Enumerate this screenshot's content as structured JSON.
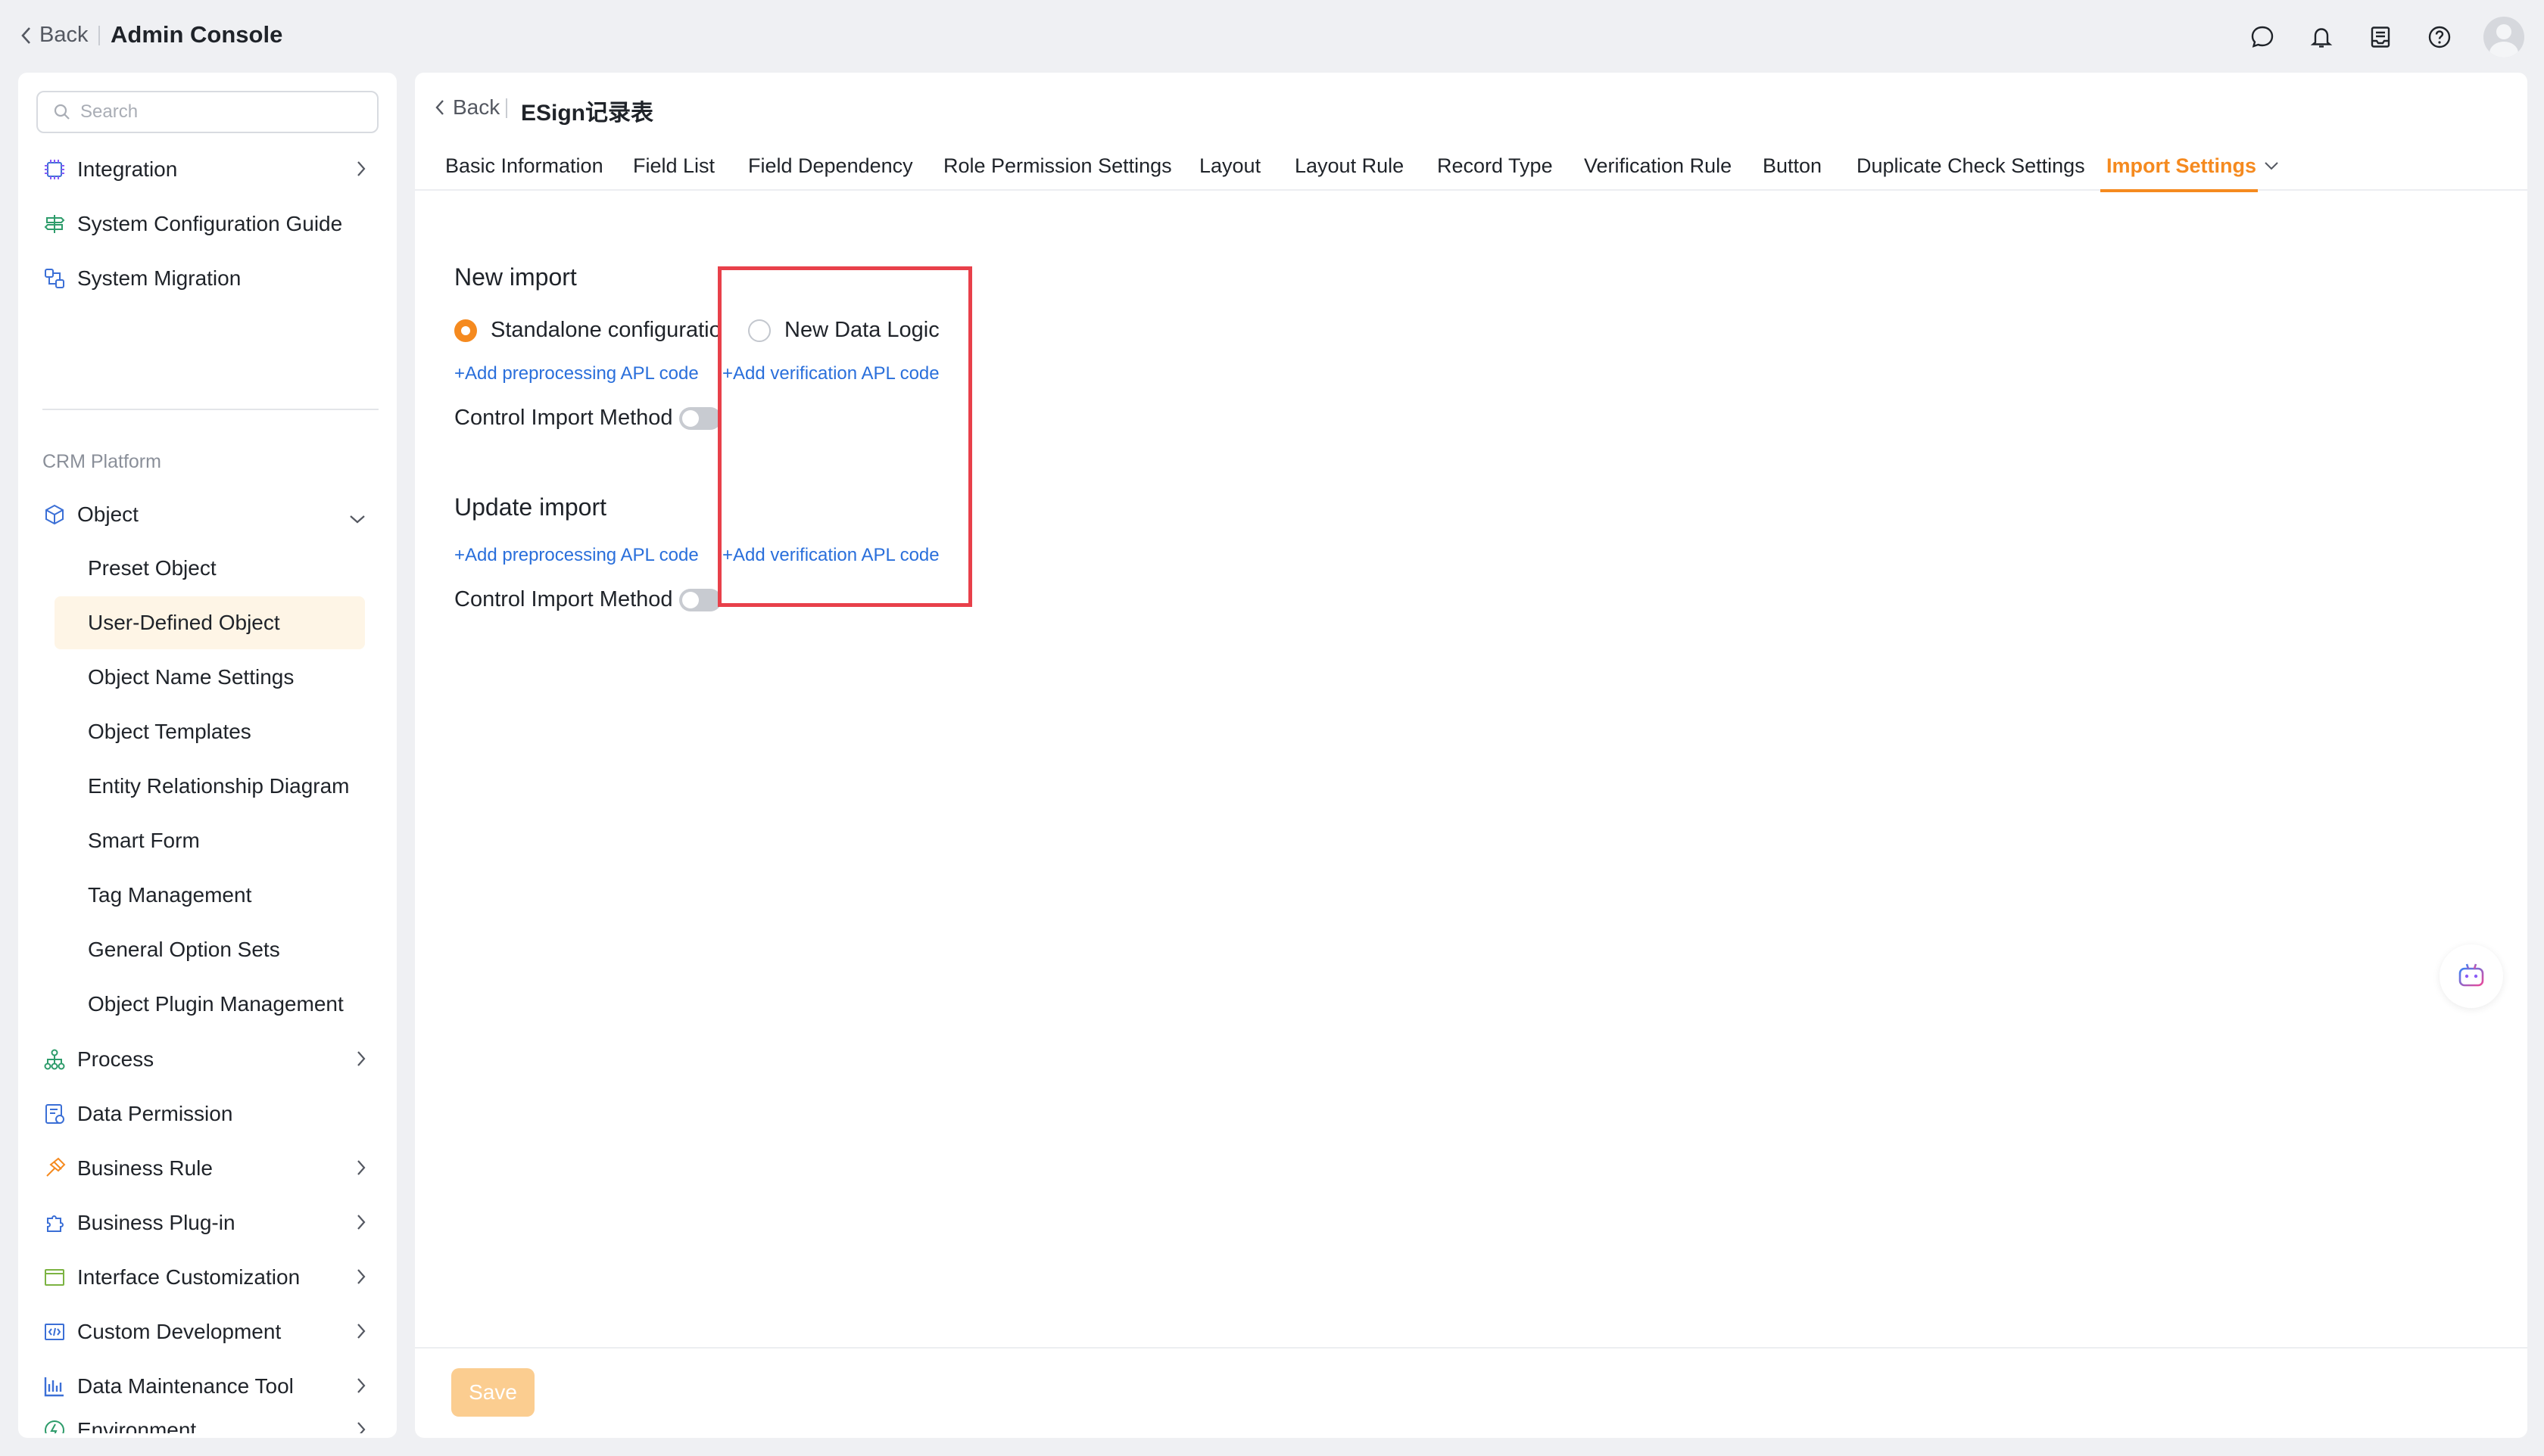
{
  "topbar": {
    "back_label": "Back",
    "title": "Admin Console",
    "icons": [
      "chat-icon",
      "bell-icon",
      "inbox-icon",
      "help-icon",
      "user-avatar"
    ]
  },
  "sidebar": {
    "search_placeholder": "Search",
    "top_items": [
      {
        "label": "Integration",
        "icon": "integration-icon"
      },
      {
        "label": "System Configuration Guide",
        "icon": "guide-icon"
      },
      {
        "label": "System Migration",
        "icon": "migration-icon"
      }
    ],
    "section_label": "CRM Platform",
    "object": {
      "label": "Object",
      "icon": "object-icon"
    },
    "object_children": [
      "Preset Object",
      "User-Defined Object",
      "Object Name Settings",
      "Object Templates",
      "Entity Relationship Diagram",
      "Smart Form",
      "Tag Management",
      "General Option Sets",
      "Object Plugin Management"
    ],
    "active_child": "User-Defined Object",
    "bottom_items": [
      {
        "label": "Process",
        "icon": "process-icon"
      },
      {
        "label": "Data Permission",
        "icon": "permission-icon"
      },
      {
        "label": "Business Rule",
        "icon": "rule-icon"
      },
      {
        "label": "Business Plug-in",
        "icon": "plugin-icon"
      },
      {
        "label": "Interface Customization",
        "icon": "interface-icon"
      },
      {
        "label": "Custom Development",
        "icon": "code-icon"
      },
      {
        "label": "Data Maintenance Tool",
        "icon": "chart-icon"
      },
      {
        "label": "Environment",
        "icon": "environment-icon"
      }
    ]
  },
  "main": {
    "back_label": "Back",
    "title": "ESign记录表",
    "tabs": [
      "Basic Information",
      "Field List",
      "Field Dependency",
      "Role Permission Settings",
      "Layout",
      "Layout Rule",
      "Record Type",
      "Verification Rule",
      "Button",
      "Duplicate Check Settings",
      "Import Settings"
    ],
    "active_tab": "Import Settings",
    "new_import": {
      "heading": "New import",
      "option_standalone": "Standalone configuration",
      "option_new_logic": "New Data Logic",
      "selected": "Standalone configuration",
      "link_preprocessing": "+Add preprocessing APL code",
      "link_verification": "+Add verification APL code",
      "control_label": "Control Import Method",
      "control_on": false
    },
    "update_import": {
      "heading": "Update import",
      "link_preprocessing": "+Add preprocessing APL code",
      "link_verification": "+Add verification APL code",
      "control_label": "Control Import Method",
      "control_on": false
    },
    "save_label": "Save"
  },
  "colors": {
    "accent": "#f58a1f",
    "link": "#2a6fdb",
    "highlight": "#e8404a",
    "save_disabled": "#fbcd90"
  }
}
